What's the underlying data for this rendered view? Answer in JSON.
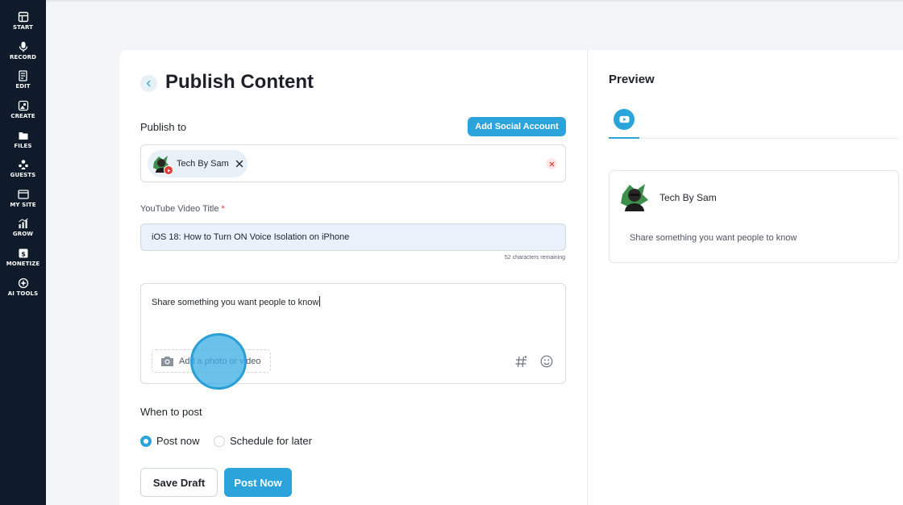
{
  "sidebar": {
    "items": [
      {
        "label": "START",
        "icon": "start-icon"
      },
      {
        "label": "RECORD",
        "icon": "microphone-icon"
      },
      {
        "label": "EDIT",
        "icon": "edit-icon"
      },
      {
        "label": "CREATE",
        "icon": "create-icon"
      },
      {
        "label": "FILES",
        "icon": "files-icon"
      },
      {
        "label": "GUESTS",
        "icon": "guests-icon"
      },
      {
        "label": "MY SITE",
        "icon": "my-site-icon"
      },
      {
        "label": "GROW",
        "icon": "grow-icon"
      },
      {
        "label": "MONETIZE",
        "icon": "monetize-icon"
      },
      {
        "label": "AI TOOLS",
        "icon": "ai-tools-icon"
      }
    ]
  },
  "page": {
    "title": "Publish Content"
  },
  "publish_to": {
    "label": "Publish to",
    "add_account_label": "Add Social Account",
    "accounts": [
      {
        "name": "Tech By Sam",
        "platform": "youtube"
      }
    ]
  },
  "video_title": {
    "label": "YouTube Video Title",
    "required_mark": "*",
    "value": "iOS 18: How to Turn ON Voice Isolation on iPhone",
    "chars_remaining": "52 characters remaining"
  },
  "description": {
    "value": "Share something you want people to know",
    "add_media_label": "Add a photo or video"
  },
  "when_to_post": {
    "label": "When to post",
    "options": [
      {
        "label": "Post now",
        "checked": true
      },
      {
        "label": "Schedule for later",
        "checked": false
      }
    ]
  },
  "actions": {
    "save_draft": "Save Draft",
    "post_now": "Post Now"
  },
  "preview": {
    "title": "Preview",
    "account_name": "Tech By Sam",
    "text": "Share something you want people to know"
  },
  "colors": {
    "accent": "#2ba4dc",
    "sidebar": "#0f1b2a",
    "danger": "#e53935"
  }
}
